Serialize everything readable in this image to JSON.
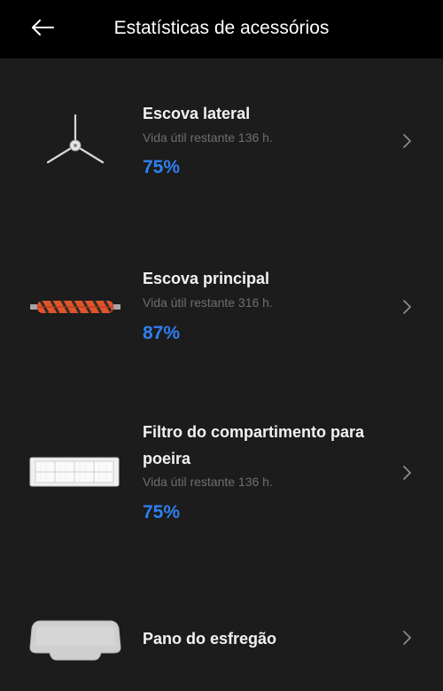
{
  "header": {
    "back_icon": "arrow-left-icon",
    "title": "Estatísticas de acessórios"
  },
  "accent_color": "#2f7ff0",
  "items": [
    {
      "name": "Escova lateral",
      "life_text": "Vida útil restante 136  h.",
      "percent": "75%",
      "icon": "side-brush-icon"
    },
    {
      "name": "Escova principal",
      "life_text": "Vida útil restante 316  h.",
      "percent": "87%",
      "icon": "main-brush-icon"
    },
    {
      "name": "Filtro do compartimento para poeira",
      "life_text": "Vida útil restante 136  h.",
      "percent": "75%",
      "icon": "dust-filter-icon"
    },
    {
      "name": "Pano do esfregão",
      "icon": "mop-cloth-icon"
    }
  ]
}
